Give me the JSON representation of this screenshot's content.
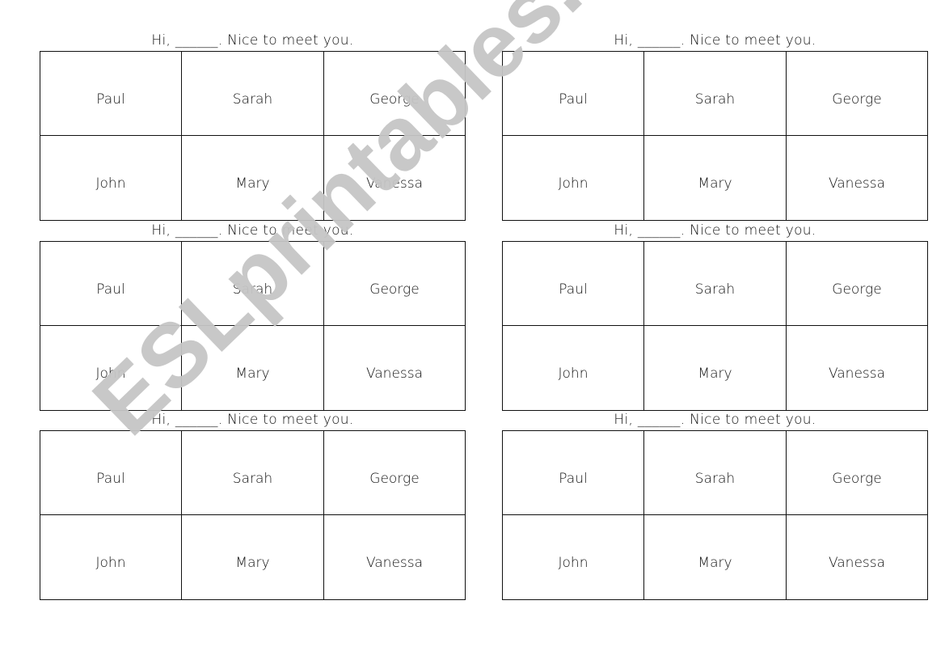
{
  "worksheet": {
    "title_text": "Hi, ______. Nice to meet you.",
    "cards": [
      {
        "title": "Hi, ______. Nice to meet you.",
        "names": [
          "Paul",
          "Sarah",
          "George",
          "John",
          "Mary",
          "Vanessa"
        ]
      },
      {
        "title": "Hi, ______. Nice to meet you.",
        "names": [
          "Paul",
          "Sarah",
          "George",
          "John",
          "Mary",
          "Vanessa"
        ]
      },
      {
        "title": "Hi, ______. Nice to meet you.",
        "names": [
          "Paul",
          "Sarah",
          "George",
          "John",
          "Mary",
          "Vanessa"
        ]
      },
      {
        "title": "Hi, ______. Nice to meet you.",
        "names": [
          "Paul",
          "Sarah",
          "George",
          "John",
          "Mary",
          "Vanessa"
        ]
      },
      {
        "title": "Hi, ______. Nice to meet you.",
        "names": [
          "Paul",
          "Sarah",
          "George",
          "John",
          "Mary",
          "Vanessa"
        ]
      },
      {
        "title": "Hi, ______. Nice to meet you.",
        "names": [
          "Paul",
          "Sarah",
          "George",
          "John",
          "Mary",
          "Vanessa"
        ]
      }
    ]
  },
  "watermark": {
    "text": "ESLprintables.com",
    "color": "#c6c6c6"
  }
}
